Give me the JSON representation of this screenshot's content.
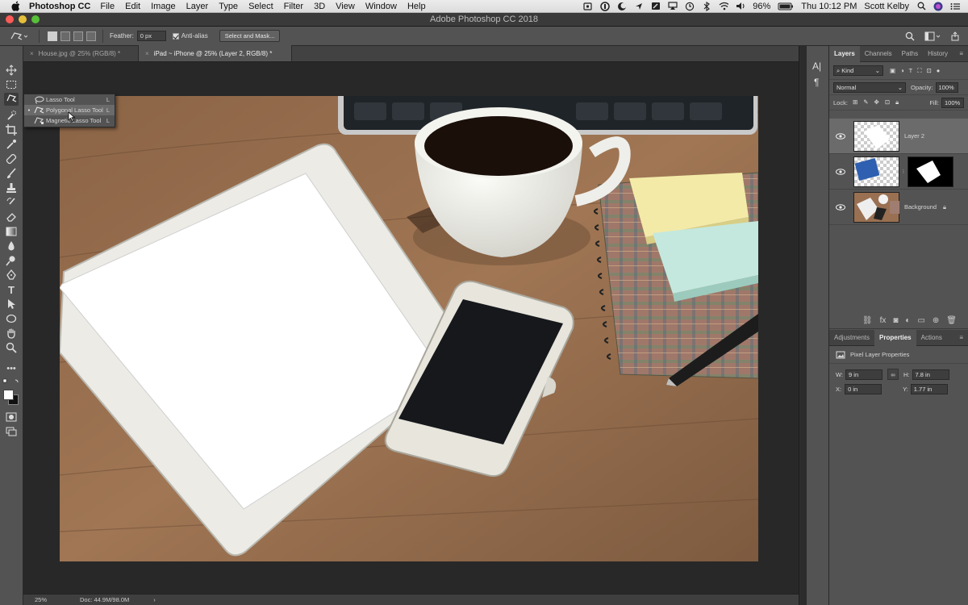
{
  "menubar": {
    "app_name": "Photoshop CC",
    "items": [
      "File",
      "Edit",
      "Image",
      "Layer",
      "Type",
      "Select",
      "Filter",
      "3D",
      "View",
      "Window",
      "Help"
    ],
    "battery": "96%",
    "clock": "Thu 10:12 PM",
    "user": "Scott Kelby"
  },
  "window": {
    "title": "Adobe Photoshop CC 2018"
  },
  "options": {
    "feather_label": "Feather:",
    "feather_value": "0 px",
    "antialias_label": "Anti-alias",
    "select_mask_label": "Select and Mask..."
  },
  "tabs": [
    {
      "label": "House.jpg @ 25% (RGB/8) *",
      "close": "×"
    },
    {
      "label": "iPad ~ iPhone @ 25% (Layer 2, RGB/8) *",
      "close": "×"
    }
  ],
  "lasso_menu": [
    {
      "label": "Lasso Tool",
      "key": "L",
      "selected": ""
    },
    {
      "label": "Polygonal Lasso Tool",
      "key": "L",
      "selected": "•"
    },
    {
      "label": "Magnetic Lasso Tool",
      "key": "L",
      "selected": ""
    }
  ],
  "status": {
    "zoom": "25%",
    "doc": "Doc: 44.9M/98.0M",
    "arrow": "›"
  },
  "layers_panel": {
    "tabs": [
      "Layers",
      "Channels",
      "Paths",
      "History"
    ],
    "filter_kind": "Kind",
    "blend_mode": "Normal",
    "opacity_label": "Opacity:",
    "opacity_value": "100%",
    "lock_label": "Lock:",
    "fill_label": "Fill:",
    "fill_value": "100%",
    "layers": [
      {
        "name": "Layer 2"
      },
      {
        "name": ""
      },
      {
        "name": "Background"
      }
    ]
  },
  "properties_panel": {
    "tabs": [
      "Adjustments",
      "Properties",
      "Actions"
    ],
    "heading": "Pixel Layer Properties",
    "w_label": "W:",
    "w_value": "9 in",
    "h_label": "H:",
    "h_value": "7.8 in",
    "x_label": "X:",
    "x_value": "0 in",
    "y_label": "Y:",
    "y_value": "1.77 in"
  },
  "colors": {
    "accent": "#535353",
    "panel_dark": "#424242",
    "selected_row": "#6b6b6b"
  }
}
